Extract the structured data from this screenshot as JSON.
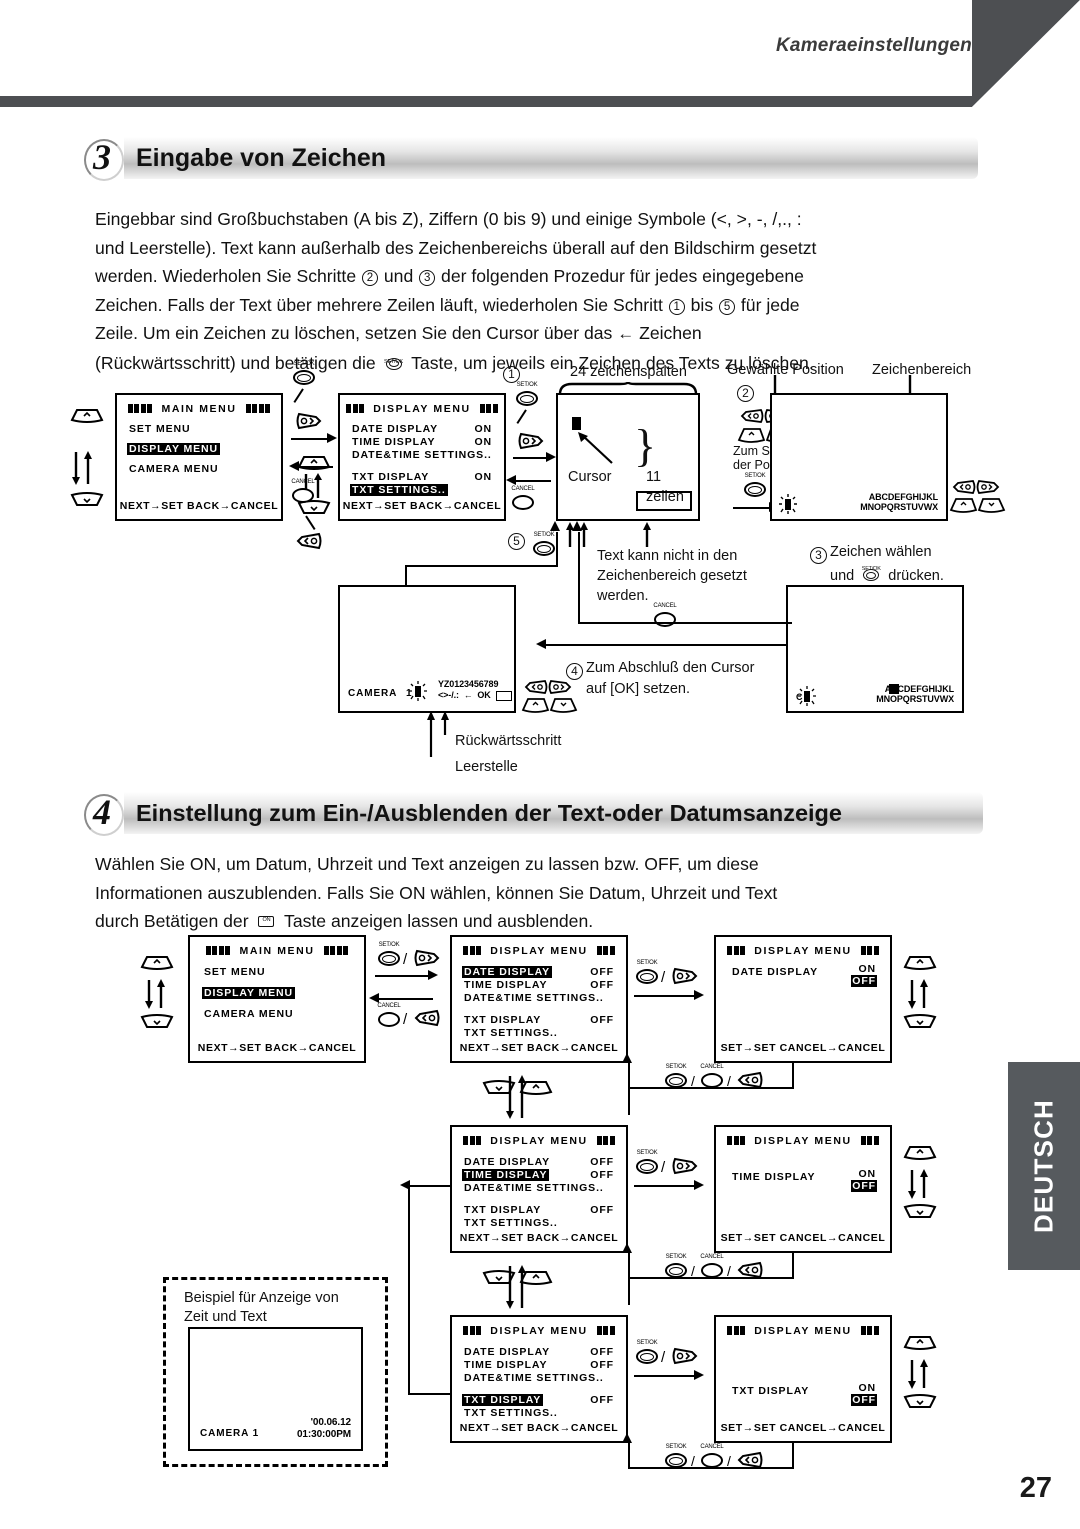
{
  "header": {
    "title": "Kameraeinstellungen"
  },
  "page_number": "27",
  "language_tab": "DEUTSCH",
  "section3": {
    "number": "3",
    "title": "Eingabe von Zeichen",
    "paragraph_lines": [
      "Eingebbar sind Großbuchstaben (A bis Z), Ziffern (0 bis 9) und einige Symbole (<, >, -, /,., :",
      "und Leerstelle). Text kann außerhalb des Zeichenbereichs überall auf den Bildschirm gesetzt",
      "werden. Wiederholen Sie Schritte ② und ③ der folgenden Prozedur für jedes eingegebene",
      "Zeichen. Falls der Text über mehrere Zeilen läuft, wiederholen Sie Schritt ① bis ⑤ für jede",
      "Zeile. Um ein Zeichen zu löschen, setzen Sie den Cursor über das ← Zeichen",
      "(Rückwärtsschritt) und betätigen die ◎ Taste, um jeweils ein Zeichen des Texts zu löschen."
    ],
    "par_a_1": "Eingebbar sind Großbuchstaben (A bis Z), Ziffern (0 bis 9) und einige Symbole (<, >, -, /,., :",
    "par_a_2": "und Leerstelle). Text kann außerhalb des Zeichenbereichs überall auf den Bildschirm gesetzt",
    "par_a_3a": "werden. Wiederholen Sie Schritte",
    "par_a_3b": "und",
    "par_a_3c": "der folgenden Prozedur für jedes eingegebene",
    "par_a_4a": "Zeichen. Falls der Text über mehrere Zeilen läuft, wiederholen Sie Schritt",
    "par_a_4b": "bis",
    "par_a_4c": "für jede",
    "par_a_5a": "Zeile. Um ein Zeichen zu löschen, setzen Sie den Cursor über das",
    "par_a_5b": "Zeichen",
    "par_a_6a": "(Rückwärtsschritt) und betätigen die",
    "par_a_6b": "Taste, um jeweils ein Zeichen des Texts zu löschen.",
    "num2": "2",
    "num3": "3",
    "num1": "1",
    "num5": "5",
    "back_arrow": "←"
  },
  "section4": {
    "number": "4",
    "title": "Einstellung zum Ein-/Ausblenden der Text-oder Datumsanzeige",
    "par_1": "Wählen Sie ON, um Datum, Uhrzeit und Text anzeigen zu lassen bzw. OFF, um diese",
    "par_2": "Informationen auszublenden. Falls Sie ON wählen, können Sie Datum, Uhrzeit und Text",
    "par_3a": "durch Betätigen der",
    "par_3b": "Taste anzeigen lassen und ausblenden."
  },
  "buttons": {
    "set_ok": "SET/OK",
    "cancel": "CANCEL",
    "on_screen": "ON SCREEN"
  },
  "osd": {
    "main_menu": {
      "title": "MAIN MENU",
      "rows": [
        "SET MENU",
        "DISPLAY MENU",
        "CAMERA MENU"
      ],
      "highlighted": "DISPLAY MENU",
      "footer": "NEXT→SET   BACK→CANCEL"
    },
    "display_menu_txt": {
      "title": "DISPLAY MENU",
      "rows": [
        {
          "label": "DATE DISPLAY",
          "value": "ON"
        },
        {
          "label": "TIME DISPLAY",
          "value": "ON"
        },
        {
          "label": "DATE&TIME SETTINGS..",
          "value": ""
        },
        {
          "label": "TXT DISPLAY",
          "value": "ON"
        },
        {
          "label": "TXT SETTINGS..",
          "value": ""
        }
      ],
      "highlighted": "TXT SETTINGS..",
      "footer": "NEXT→SET   BACK→CANCEL"
    },
    "display_menu_off": {
      "title": "DISPLAY MENU",
      "rows": [
        {
          "label": "DATE DISPLAY",
          "value": "OFF"
        },
        {
          "label": "TIME DISPLAY",
          "value": "OFF"
        },
        {
          "label": "DATE&TIME SETTINGS..",
          "value": ""
        },
        {
          "label": "TXT DISPLAY",
          "value": "OFF"
        },
        {
          "label": "TXT SETTINGS..",
          "value": ""
        }
      ],
      "footer": "NEXT→SET   BACK→CANCEL"
    },
    "toggle_screen": {
      "title": "DISPLAY MENU",
      "on": "ON",
      "off": "OFF",
      "footer": "SET→SET CANCEL→CANCEL",
      "labels": {
        "date": "DATE DISPLAY",
        "time": "TIME DISPLAY",
        "txt": "TXT DISPLAY"
      }
    },
    "charset_line1": "ABCDEFGHIJKL",
    "charset_line2": "MNOPQRSTUVWX",
    "charset2_line1": "YZ0123456789",
    "charset2_line2": "<>-/.:  ←  OK",
    "camera_label": "CAMERA",
    "example": {
      "caption_1": "Beispiel für Anzeige von",
      "caption_2": "Zeit und Text",
      "camera": "CAMERA 1",
      "date": "'00.06.12",
      "time": "01:30:00PM"
    }
  },
  "annotations": {
    "step1": "1",
    "step2": "2",
    "step3": "3",
    "step4": "4",
    "step5": "5",
    "cols": "24 zeichenspalten",
    "rows": "11 zeilen",
    "cursor": "Cursor",
    "chosen_position": "Gewählte Position",
    "character_area": "Zeichenbereich",
    "set_position_1": "Zum Setzen",
    "set_position_2": "der Position",
    "note_text_1": "Text kann nicht in den",
    "note_text_2": "Zeichenbereich gesetzt",
    "note_text_3": "werden.",
    "step3_text_1": "Zeichen wählen",
    "step3_text_2a": "und",
    "step3_text_2b": "drücken.",
    "step4_text_1": "Zum Abschluß den Cursor",
    "step4_text_2": "auf [OK] setzen.",
    "backspace": "Rückwärtsschritt",
    "space": "Leerstelle"
  }
}
